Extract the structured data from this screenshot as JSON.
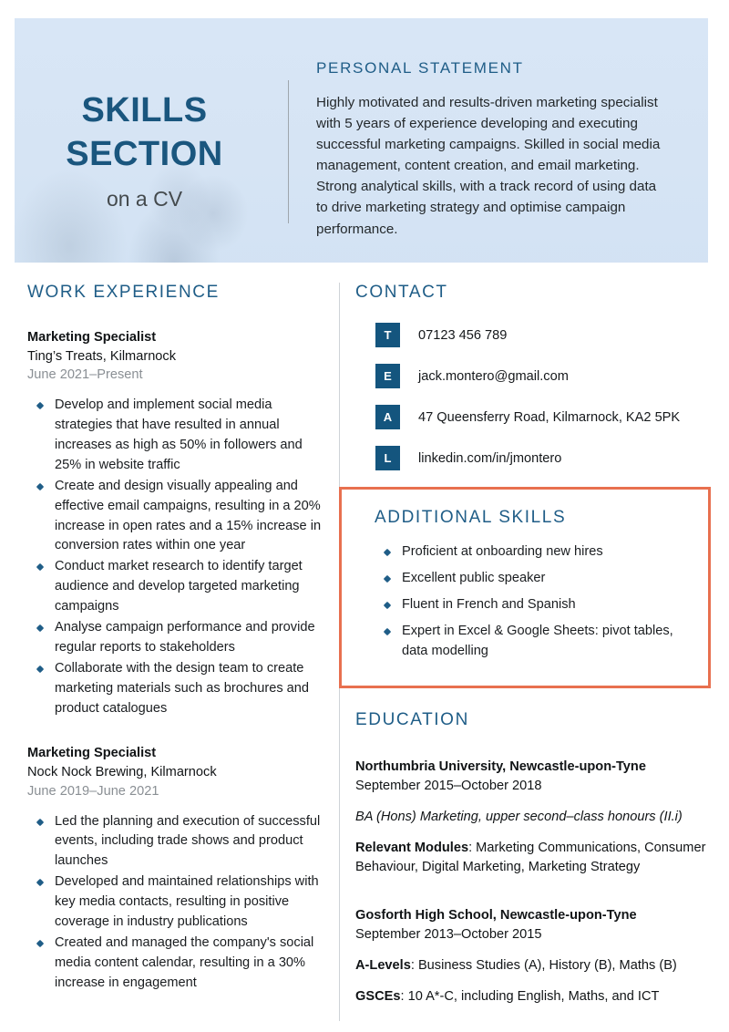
{
  "header": {
    "title_line1": "SKILLS",
    "title_line2": "SECTION",
    "subtitle": "on a CV",
    "personal_statement": {
      "heading": "PERSONAL STATEMENT",
      "body": "Highly motivated and results-driven marketing specialist with 5 years of experience developing and executing successful marketing campaigns. Skilled in social media management, content creation, and email marketing. Strong analytical skills, with a track record of using data to drive marketing strategy and optimise campaign performance."
    }
  },
  "work_experience": {
    "heading": "WORK EXPERIENCE",
    "jobs": [
      {
        "title": "Marketing Specialist",
        "company": "Ting’s Treats, Kilmarnock",
        "dates": "June 2021–Present",
        "bullets": [
          "Develop and implement social media strategies that have resulted in annual increases as high as 50% in followers and 25% in website traffic",
          "Create and design visually appealing and effective email campaigns, resulting in a 20% increase in open rates and a 15% increase in conversion rates within one year",
          "Conduct market research to identify target audience and develop targeted marketing campaigns",
          "Analyse campaign performance and provide regular reports to stakeholders",
          "Collaborate with the design team to create marketing materials such as brochures and product catalogues"
        ]
      },
      {
        "title": "Marketing Specialist",
        "company": "Nock Nock Brewing, Kilmarnock",
        "dates": "June 2019–June 2021",
        "bullets": [
          "Led the planning and execution of successful events, including trade shows and product launches",
          "Developed and maintained relationships with key media contacts, resulting in positive coverage in industry publications",
          "Created and managed the company's social media content calendar, resulting in a 30% increase in engagement"
        ]
      }
    ]
  },
  "contact": {
    "heading": "CONTACT",
    "items": [
      {
        "badge": "T",
        "icon": "telephone-icon",
        "value": "07123 456 789"
      },
      {
        "badge": "E",
        "icon": "email-icon",
        "value": "jack.montero@gmail.com"
      },
      {
        "badge": "A",
        "icon": "address-icon",
        "value": "47 Queensferry Road, Kilmarnock, KA2 5PK"
      },
      {
        "badge": "L",
        "icon": "linkedin-icon",
        "value": "linkedin.com/in/jmontero"
      }
    ]
  },
  "additional_skills": {
    "heading": "ADDITIONAL SKILLS",
    "highlight_color": "#e8704f",
    "items": [
      "Proficient at onboarding new hires",
      "Excellent public speaker",
      "Fluent in French and Spanish",
      "Expert in Excel & Google Sheets: pivot tables, data modelling"
    ]
  },
  "education": {
    "heading": "EDUCATION",
    "entries": [
      {
        "school": "Northumbria University, Newcastle-upon-Tyne",
        "dates": "September 2015–October 2018",
        "degree": "BA (Hons) Marketing, upper second–class honours (II.i)",
        "detail_label": "Relevant Modules",
        "detail_text": ": Marketing Communications, Consumer Behaviour, Digital Marketing, Marketing Strategy"
      },
      {
        "school": "Gosforth High School, Newcastle-upon-Tyne",
        "dates": "September 2013–October 2015",
        "alevels_label": "A-Levels",
        "alevels_text": ": Business Studies (A), History (B), Maths (B)",
        "gcses_label": "GSCEs",
        "gcses_text": ": 10 A*-C, including English, Maths, and ICT"
      }
    ]
  },
  "theme": {
    "band_bg": "#d8e6f6",
    "heading_blue": "#1f5d87",
    "title_blue": "#1a567e",
    "badge_blue": "#14557e",
    "accent_orange": "#e8704f",
    "muted_gray": "#8a8f94"
  }
}
